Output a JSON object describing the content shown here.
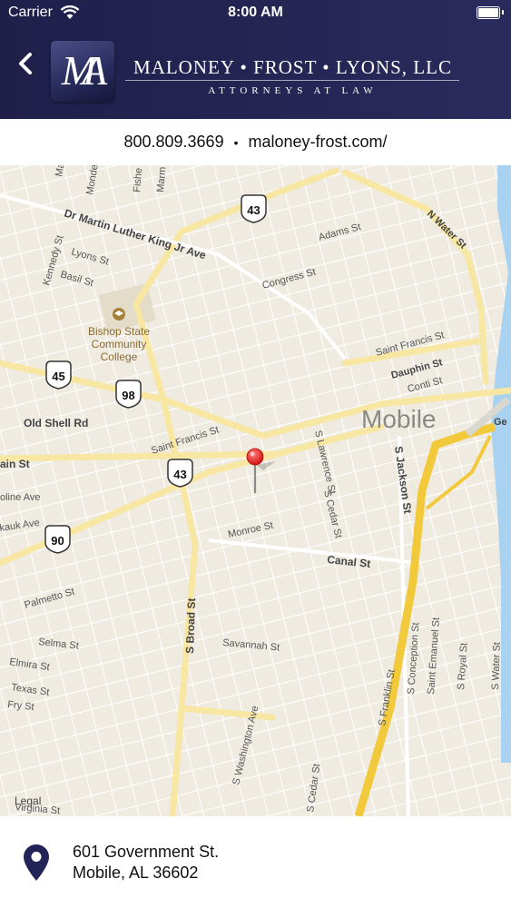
{
  "status_bar": {
    "carrier": "Carrier",
    "time": "8:00 AM"
  },
  "header": {
    "logo_text": "MA",
    "firm_name": "MALONEY • FROST • LYONS, LLC",
    "firm_subtitle": "ATTORNEYS AT LAW"
  },
  "contact": {
    "phone": "800.809.3669",
    "separator": "•",
    "website": "maloney-frost.com/"
  },
  "map": {
    "city_label": "Mobile",
    "legal_label": "Legal",
    "pin_color": "#e02020",
    "water_color": "#a8d2f0",
    "highway_color": "#f2c93a",
    "landmark": {
      "line1": "Bishop State",
      "line2": "Community",
      "line3": "College"
    },
    "shields": {
      "s43a": "43",
      "s45": "45",
      "s98": "98",
      "s43b": "43",
      "s90": "90"
    },
    "streets": {
      "mlk": "Dr Martin Luther King Jr Ave",
      "adams": "Adams St",
      "n_water": "N Water St",
      "lyons": "Lyons St",
      "basil": "Basil St",
      "kennedy": "Kennedy St",
      "congress": "Congress St",
      "saint_francis_e": "Saint Francis St",
      "dauphin": "Dauphin St",
      "conti": "Conti St",
      "old_shell": "Old Shell Rd",
      "saint_francis_w": "Saint Francis St",
      "main_w": "ain St",
      "gov": "Ge",
      "s_lawrence": "S Lawrence St",
      "s_jackson": "S Jackson St",
      "s_cedar_n": "S Cedar St",
      "canal": "Canal St",
      "monroe": "Monroe St",
      "oline": "oline Ave",
      "kauk": "kauk Ave",
      "palmetto": "Palmetto St",
      "s_broad": "S Broad St",
      "selma": "Selma St",
      "savannah": "Savannah St",
      "elmira": "Elmira St",
      "texas": "Texas St",
      "fry": "Fry St",
      "s_franklin": "S Franklin St",
      "s_conception": "S Conception St",
      "saint_emanuel": "Saint Emanuel St",
      "s_royal": "S Royal St",
      "s_water": "S Water St",
      "s_washington": "S Washington Ave",
      "s_cedar_s": "S Cedar St",
      "virginia": "Virginia St",
      "top1": "Ma",
      "top2": "Monde",
      "top3": "Fishe",
      "top4": "Marm"
    }
  },
  "address": {
    "line1": "601 Government St.",
    "line2": "Mobile, AL 36602"
  }
}
